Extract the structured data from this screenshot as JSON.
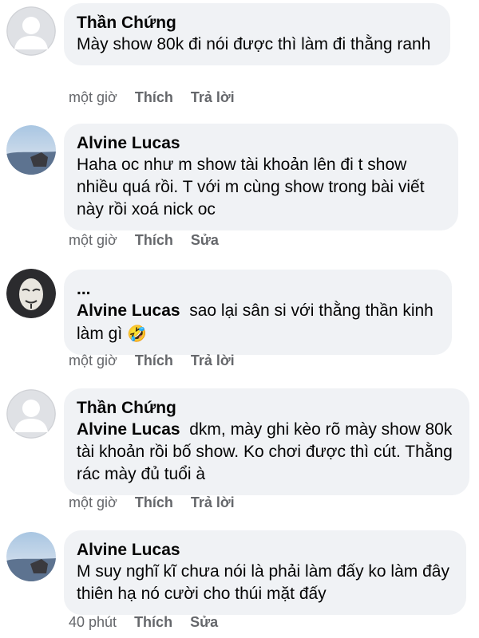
{
  "comments": [
    {
      "author": "Thần Chứng",
      "text": "Mày show 80k đi nói được thì làm đi thằng ranh",
      "time": "một giờ",
      "action1": "Thích",
      "action2": "Trả lời"
    },
    {
      "author": "Alvine Lucas",
      "text": "Haha oc như m show tài khoản lên đi t show nhiều quá rồi. T với m cùng show trong bài viết này rồi xoá nick oc",
      "time": "một giờ",
      "action1": "Thích",
      "action2": "Sửa"
    },
    {
      "author": "...",
      "mention": "Alvine Lucas",
      "text": "sao lại sân si với thằng thần kinh làm gì",
      "emoji": "🤣",
      "time": "một giờ",
      "action1": "Thích",
      "action2": "Trả lời"
    },
    {
      "author": "Thần Chứng",
      "mention": "Alvine Lucas",
      "text": "dkm, mày ghi kèo rõ mày show 80k tài khoản rồi bố show. Ko chơi được thì cút. Thằng rác mày đủ tuổi à",
      "time": "một giờ",
      "action1": "Thích",
      "action2": "Trả lời"
    },
    {
      "author": "Alvine Lucas",
      "text": "M suy nghĩ kĩ chưa nói là phải làm đấy ko làm đây thiên hạ nó cười cho thúi mặt đấy",
      "time": "40 phút",
      "action1": "Thích",
      "action2": "Sửa"
    }
  ]
}
